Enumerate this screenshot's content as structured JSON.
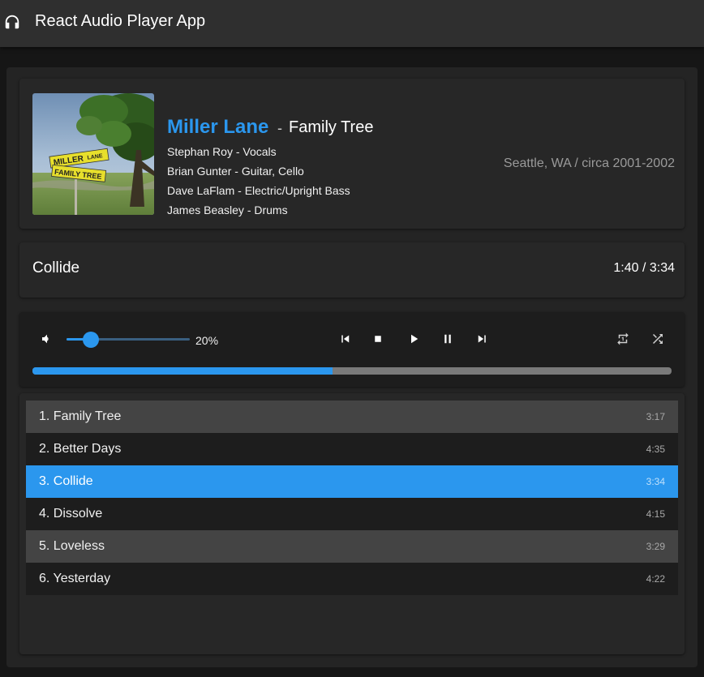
{
  "app": {
    "title": "React Audio Player App"
  },
  "album": {
    "band": "Miller Lane",
    "separator": "-",
    "title": "Family Tree",
    "members": [
      "Stephan Roy - Vocals",
      "Brian Gunter - Guitar, Cello",
      "Dave LaFlam - Electric/Upright Bass",
      "James Beasley - Drums"
    ],
    "location": "Seattle, WA / circa 2001-2002",
    "art_sign_text": [
      "MILLER",
      "LANE",
      "FAMILY TREE"
    ]
  },
  "now_playing": {
    "title": "Collide",
    "time": "1:40 / 3:34"
  },
  "controls": {
    "volume_percent": 20,
    "volume_label": "20%",
    "progress_fraction": 0.47,
    "icons": [
      "volume-icon",
      "skip-previous-icon",
      "stop-icon",
      "play-icon",
      "pause-icon",
      "skip-next-icon",
      "repeat-icon",
      "shuffle-icon"
    ]
  },
  "playlist": [
    {
      "label": "1. Family Tree",
      "duration": "3:17"
    },
    {
      "label": "2. Better Days",
      "duration": "4:35"
    },
    {
      "label": "3. Collide",
      "duration": "3:34",
      "active": true
    },
    {
      "label": "4. Dissolve",
      "duration": "4:15"
    },
    {
      "label": "5. Loveless",
      "duration": "3:29"
    },
    {
      "label": "6. Yesterday",
      "duration": "4:22"
    }
  ],
  "colors": {
    "accent": "#2b97ee",
    "appbar": "#2f2f2f",
    "background": "#161616",
    "panel": "#242424"
  }
}
